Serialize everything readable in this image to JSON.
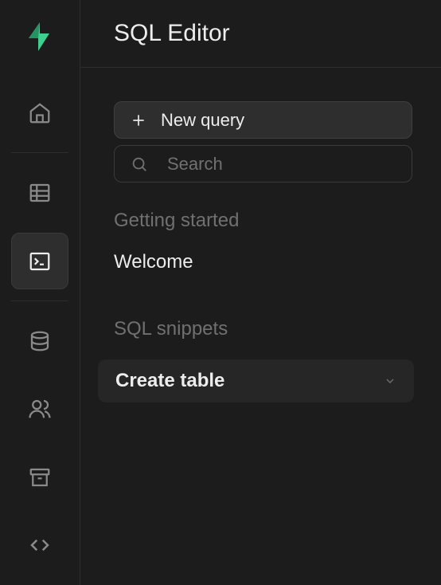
{
  "header": {
    "title": "SQL Editor"
  },
  "actions": {
    "new_query_label": "New query",
    "search_placeholder": "Search"
  },
  "sections": {
    "getting_started_label": "Getting started",
    "welcome_label": "Welcome",
    "snippets_label": "SQL snippets",
    "create_table_label": "Create table"
  }
}
